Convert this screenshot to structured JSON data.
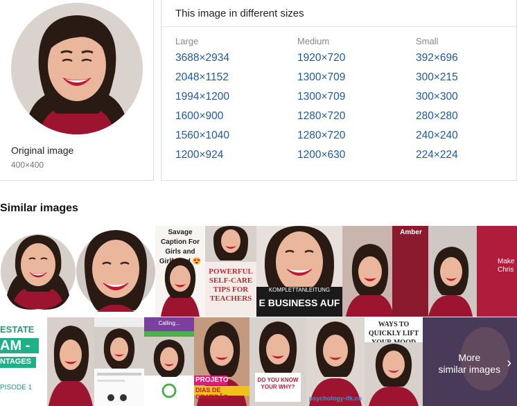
{
  "original": {
    "label": "Original image",
    "size": "400×400"
  },
  "sizes": {
    "title": "This image in different sizes",
    "columns": [
      {
        "heading": "Large",
        "items": [
          "3688×2934",
          "2048×1152",
          "1994×1200",
          "1600×900",
          "1560×1040",
          "1200×924"
        ]
      },
      {
        "heading": "Medium",
        "items": [
          "1920×720",
          "1300×709",
          "1300×709",
          "1280×720",
          "1280×720",
          "1200×630"
        ]
      },
      {
        "heading": "Small",
        "items": [
          "392×696",
          "300×215",
          "300×300",
          "280×280",
          "240×240",
          "224×224"
        ]
      }
    ]
  },
  "similar": {
    "title": "Similar images",
    "tiles_texts": {
      "savage_caption": "Savage Caption For Girls and Girlfriend 😍",
      "self_care": "POWERFUL SELF-CARE TIPS FOR TEACHERS",
      "komplett": "KOMPLETTANLEITUNG",
      "business": "E BUSINESS AUF",
      "amber": "Amber",
      "estate": "ESTATE",
      "am": "AM -",
      "ntages": "NTAGES",
      "episode": "PISODE 1",
      "projeto": "PROJETO",
      "gratidao": "DIAS DE GRATIDÃO",
      "know_why": "DO YOU KNOW YOUR WHY?",
      "ways": "WAYS TO QUICKLY LIFT YOUR MOOD",
      "calling": "Calling...",
      "psychology": "psychology-ifk.co",
      "make": "Make Chris"
    },
    "more_label_1": "More",
    "more_label_2": "similar images"
  },
  "colors": {
    "link": "#1c5aa0",
    "shirt": "#9c1430",
    "hair": "#2a1a14",
    "skin": "#e8b49a"
  }
}
